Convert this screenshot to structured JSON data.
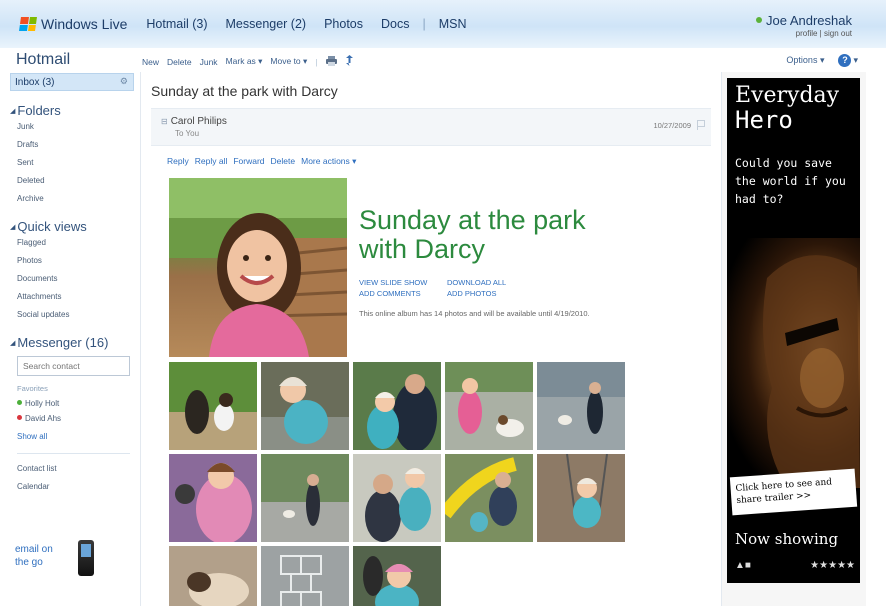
{
  "topbar": {
    "brand": "Windows Live",
    "nav": [
      "Hotmail (3)",
      "Messenger (2)",
      "Photos",
      "Docs",
      "MSN"
    ],
    "user_name": "Joe Andreshak",
    "user_links": "profile | sign out"
  },
  "toolbar": {
    "title": "Hotmail",
    "buttons": [
      "New",
      "Delete",
      "Junk",
      "Mark as ▾",
      "Move to ▾"
    ],
    "options_label": "Options ▾"
  },
  "sidebar": {
    "inbox_label": "Inbox (3)",
    "folders_head": "Folders",
    "folders": [
      "Junk",
      "Drafts",
      "Sent",
      "Deleted",
      "Archive"
    ],
    "quick_head": "Quick views",
    "quick": [
      "Flagged",
      "Photos",
      "Documents",
      "Attachments",
      "Social updates"
    ],
    "messenger_head": "Messenger (16)",
    "search_placeholder": "Search contact",
    "favorites_label": "Favorites",
    "contacts": [
      {
        "name": "Holly Holt",
        "status_color": "#4caf3a"
      },
      {
        "name": "David Ahs",
        "status_color": "#d9363e"
      }
    ],
    "show_all": "Show all",
    "links": [
      "Contact list",
      "Calendar"
    ],
    "email_on": "email on",
    "the_go": "the go"
  },
  "message": {
    "subject": "Sunday at the park with Darcy",
    "sender": "Carol Philips",
    "to": "To You",
    "date": "10/27/2009",
    "actions": [
      "Reply",
      "Reply all",
      "Forward",
      "Delete",
      "More actions ▾"
    ],
    "album_title_line1": "Sunday at the park",
    "album_title_line2": "with Darcy",
    "link_slideshow": "VIEW SLIDE SHOW",
    "link_download": "DOWNLOAD ALL",
    "link_comments": "ADD COMMENTS",
    "link_photos": "ADD PHOTOS",
    "note": "This online album has 14 photos and will be available until 4/19/2010."
  },
  "ad": {
    "title_line1": "Everyday",
    "title_line2": "Hero",
    "question": "Could you save the world if you had to?",
    "click_text": "Click here to see and share trailer >>",
    "now_showing": "Now showing"
  },
  "colors": {
    "accent_blue": "#2f6fbf",
    "album_green": "#2c8a3e",
    "inbox_highlight": "#d3e6f7",
    "logo_flag": [
      "#f25022",
      "#7fba00",
      "#00a4ef",
      "#ffb900"
    ]
  }
}
